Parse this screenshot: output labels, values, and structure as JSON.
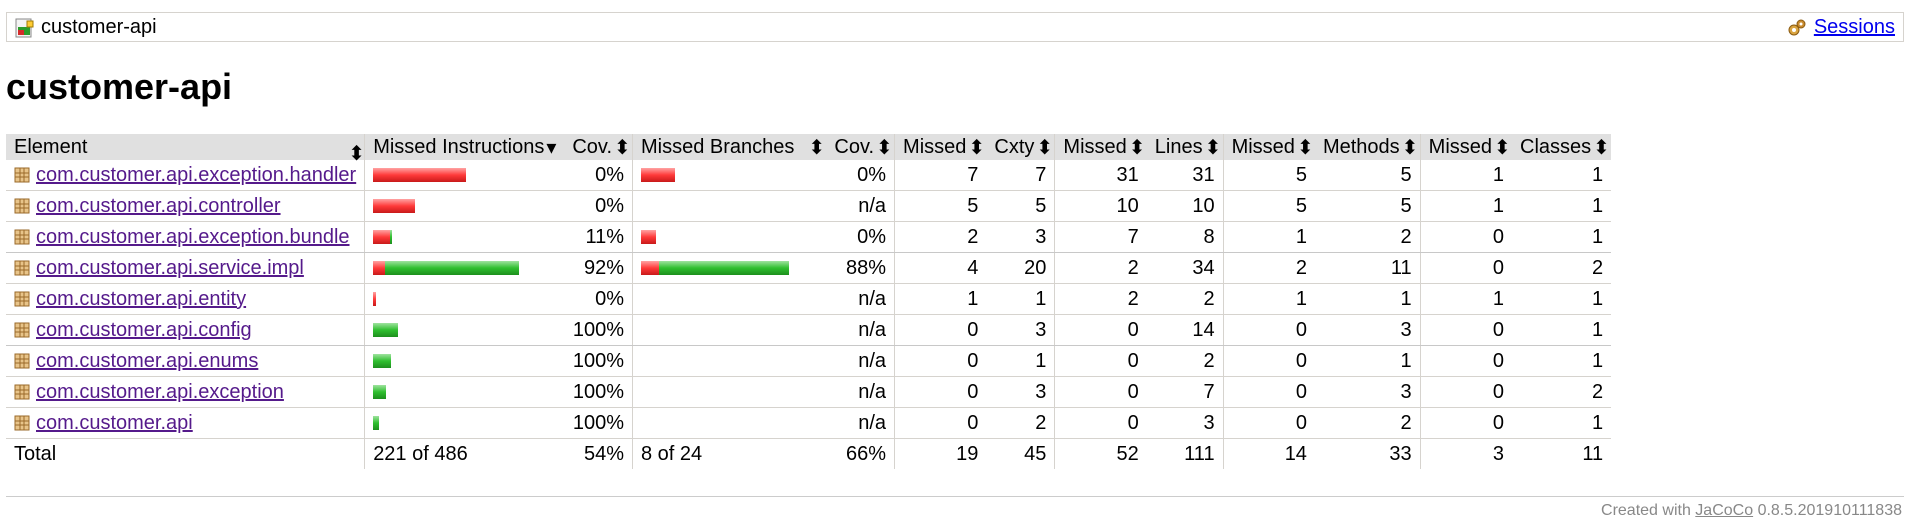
{
  "breadcrumb": {
    "report_name": "customer-api",
    "sessions_label": "Sessions",
    "report_icon": "report-icon",
    "sessions_icon": "gears-icon"
  },
  "page_title": "customer-api",
  "table": {
    "headers": [
      "Element",
      "Missed Instructions",
      "Cov.",
      "Missed Branches",
      "Cov.",
      "Missed",
      "Cxty",
      "Missed",
      "Lines",
      "Missed",
      "Methods",
      "Missed",
      "Classes"
    ],
    "rows": [
      {
        "name": "com.customer.api.exception.handler",
        "instr_missed_frac": 1.0,
        "instr_cov": "0%",
        "branch_missed_frac": 1.0,
        "branch_present": true,
        "branch_cov": "0%",
        "cxty_missed": "7",
        "cxty": "7",
        "lines_missed": "31",
        "lines": "31",
        "methods_missed": "5",
        "methods": "5",
        "classes_missed": "1",
        "classes": "1"
      },
      {
        "name": "com.customer.api.controller",
        "instr_missed_frac": 1.0,
        "instr_cov": "0%",
        "branch_missed_frac": 0,
        "branch_present": false,
        "branch_cov": "n/a",
        "cxty_missed": "5",
        "cxty": "5",
        "lines_missed": "10",
        "lines": "10",
        "methods_missed": "5",
        "methods": "5",
        "classes_missed": "1",
        "classes": "1"
      },
      {
        "name": "com.customer.api.exception.bundle",
        "instr_missed_frac": 0.89,
        "instr_cov": "11%",
        "branch_missed_frac": 1.0,
        "branch_present": true,
        "branch_cov": "0%",
        "cxty_missed": "2",
        "cxty": "3",
        "lines_missed": "7",
        "lines": "8",
        "methods_missed": "1",
        "methods": "2",
        "classes_missed": "0",
        "classes": "1"
      },
      {
        "name": "com.customer.api.service.impl",
        "instr_missed_frac": 0.08,
        "instr_cov": "92%",
        "branch_missed_frac": 0.12,
        "branch_present": true,
        "branch_cov": "88%",
        "cxty_missed": "4",
        "cxty": "20",
        "lines_missed": "2",
        "lines": "34",
        "methods_missed": "2",
        "methods": "11",
        "classes_missed": "0",
        "classes": "2"
      },
      {
        "name": "com.customer.api.entity",
        "instr_missed_frac": 1.0,
        "instr_cov": "0%",
        "branch_missed_frac": 0,
        "branch_present": false,
        "branch_cov": "n/a",
        "cxty_missed": "1",
        "cxty": "1",
        "lines_missed": "2",
        "lines": "2",
        "methods_missed": "1",
        "methods": "1",
        "classes_missed": "1",
        "classes": "1"
      },
      {
        "name": "com.customer.api.config",
        "instr_missed_frac": 0,
        "instr_cov": "100%",
        "branch_missed_frac": 0,
        "branch_present": false,
        "branch_cov": "n/a",
        "cxty_missed": "0",
        "cxty": "3",
        "lines_missed": "0",
        "lines": "14",
        "methods_missed": "0",
        "methods": "3",
        "classes_missed": "0",
        "classes": "1"
      },
      {
        "name": "com.customer.api.enums",
        "instr_missed_frac": 0,
        "instr_cov": "100%",
        "branch_missed_frac": 0,
        "branch_present": false,
        "branch_cov": "n/a",
        "cxty_missed": "0",
        "cxty": "1",
        "lines_missed": "0",
        "lines": "2",
        "methods_missed": "0",
        "methods": "1",
        "classes_missed": "0",
        "classes": "1"
      },
      {
        "name": "com.customer.api.exception",
        "instr_missed_frac": 0,
        "instr_cov": "100%",
        "branch_missed_frac": 0,
        "branch_present": false,
        "branch_cov": "n/a",
        "cxty_missed": "0",
        "cxty": "3",
        "lines_missed": "0",
        "lines": "7",
        "methods_missed": "0",
        "methods": "3",
        "classes_missed": "0",
        "classes": "2"
      },
      {
        "name": "com.customer.api",
        "instr_missed_frac": 0,
        "instr_cov": "100%",
        "branch_missed_frac": 0,
        "branch_present": false,
        "branch_cov": "n/a",
        "cxty_missed": "0",
        "cxty": "2",
        "lines_missed": "0",
        "lines": "3",
        "methods_missed": "0",
        "methods": "2",
        "classes_missed": "0",
        "classes": "1"
      }
    ],
    "total": {
      "label": "Total",
      "instr": "221 of 486",
      "instr_cov": "54%",
      "branch": "8 of 24",
      "branch_cov": "66%",
      "cxty_missed": "19",
      "cxty": "45",
      "lines_missed": "52",
      "lines": "111",
      "methods_missed": "14",
      "methods": "33",
      "classes_missed": "3",
      "classes": "11"
    }
  },
  "footer": {
    "prefix": "Created with",
    "link": "JaCoCo",
    "version": "0.8.5.201910111838"
  },
  "colors": {
    "missed": "#ff3a3a",
    "covered": "#2fbf2f",
    "header_bg": "#e0e0e0",
    "link": "#551a8b"
  }
}
